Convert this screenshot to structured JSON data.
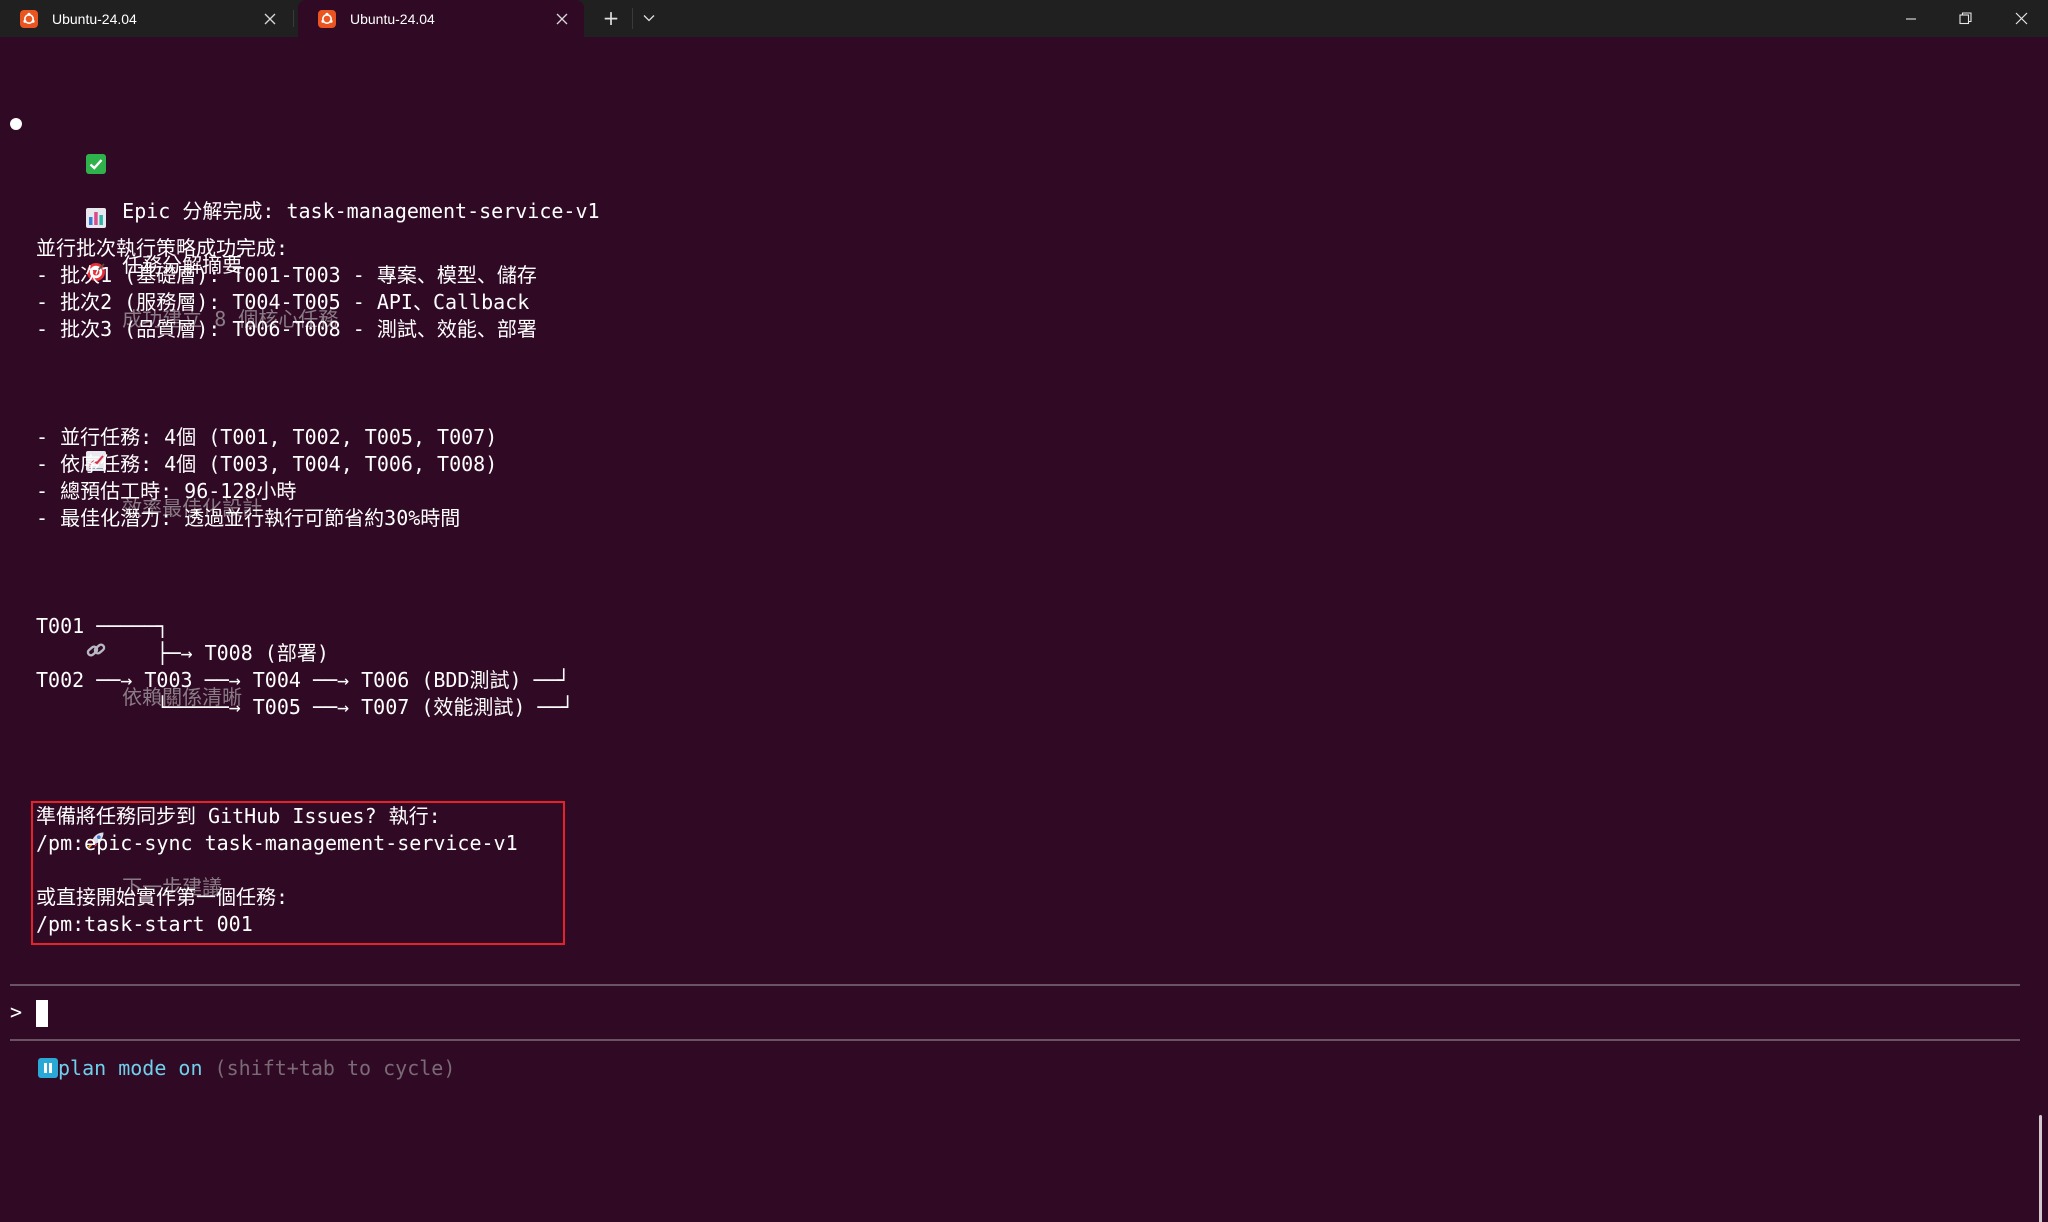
{
  "window": {
    "tabs": [
      {
        "title": "Ubuntu-24.04",
        "active": false
      },
      {
        "title": "Ubuntu-24.04",
        "active": true
      }
    ],
    "new_tab_symbol": "+",
    "accent_color": "#e95420"
  },
  "terminal": {
    "background_color": "#300a24",
    "header": "Epic 分解完成: task-management-service-v1",
    "summary_title": "任務分解摘要",
    "section_success": "成功建立 8 個核心任務",
    "parallel_intro": "並行批次執行策略成功完成:",
    "batches": [
      "- 批次1 (基礎層): T001-T003 - 專案、模型、儲存",
      "- 批次2 (服務層): T004-T005 - API、Callback",
      "- 批次3 (品質層): T006-T008 - 測試、效能、部署"
    ],
    "section_efficiency": "效率最佳化設計",
    "efficiency_items": [
      "- 並行任務: 4個 (T001, T002, T005, T007)",
      "- 依序任務: 4個 (T003, T004, T006, T008)",
      "- 總預估工時: 96-128小時",
      "- 最佳化潛力: 透過並行執行可節省約30%時間"
    ],
    "section_dependencies": "依賴關係清晰",
    "dependency_diagram": [
      "T001 ─────┐",
      "          ├─→ T008 (部署)",
      "T002 ──→ T003 ──→ T004 ──→ T006 (BDD測試) ──┘",
      "          └─────→ T005 ──→ T007 (效能測試) ──┘"
    ],
    "section_next": "下一步建議",
    "next_steps": [
      "準備將任務同步到 GitHub Issues? 執行:",
      "/pm:epic-sync task-management-service-v1",
      "",
      "或直接開始實作第一個任務:",
      "/pm:task-start 001"
    ],
    "prompt_symbol": ">",
    "mode_label": "plan mode on",
    "mode_hint": "(shift+tab to cycle)"
  }
}
